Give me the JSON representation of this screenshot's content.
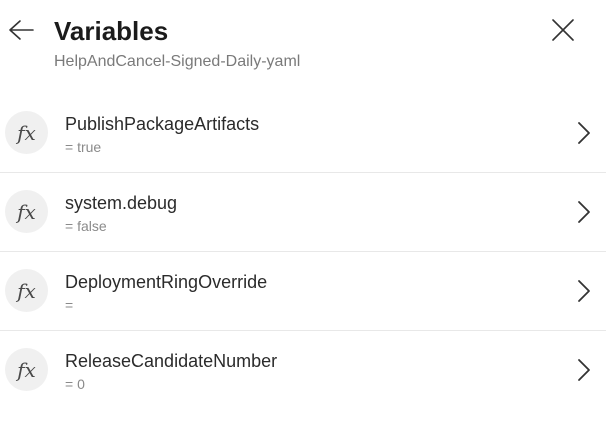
{
  "header": {
    "title": "Variables",
    "subtitle": "HelpAndCancel-Signed-Daily-yaml",
    "back_icon": "arrow-left-icon",
    "close_icon": "close-icon"
  },
  "variables": [
    {
      "icon_text": "fx",
      "name": "PublishPackageArtifacts",
      "value": "= true"
    },
    {
      "icon_text": "fx",
      "name": "system.debug",
      "value": "= false"
    },
    {
      "icon_text": "fx",
      "name": "DeploymentRingOverride",
      "value": "="
    },
    {
      "icon_text": "fx",
      "name": "ReleaseCandidateNumber",
      "value": "= 0"
    }
  ],
  "colors": {
    "text_primary": "#201f1e",
    "text_secondary": "#8a8a8a",
    "badge_bg": "#f0f0f0",
    "divider": "#e8e8e8"
  }
}
